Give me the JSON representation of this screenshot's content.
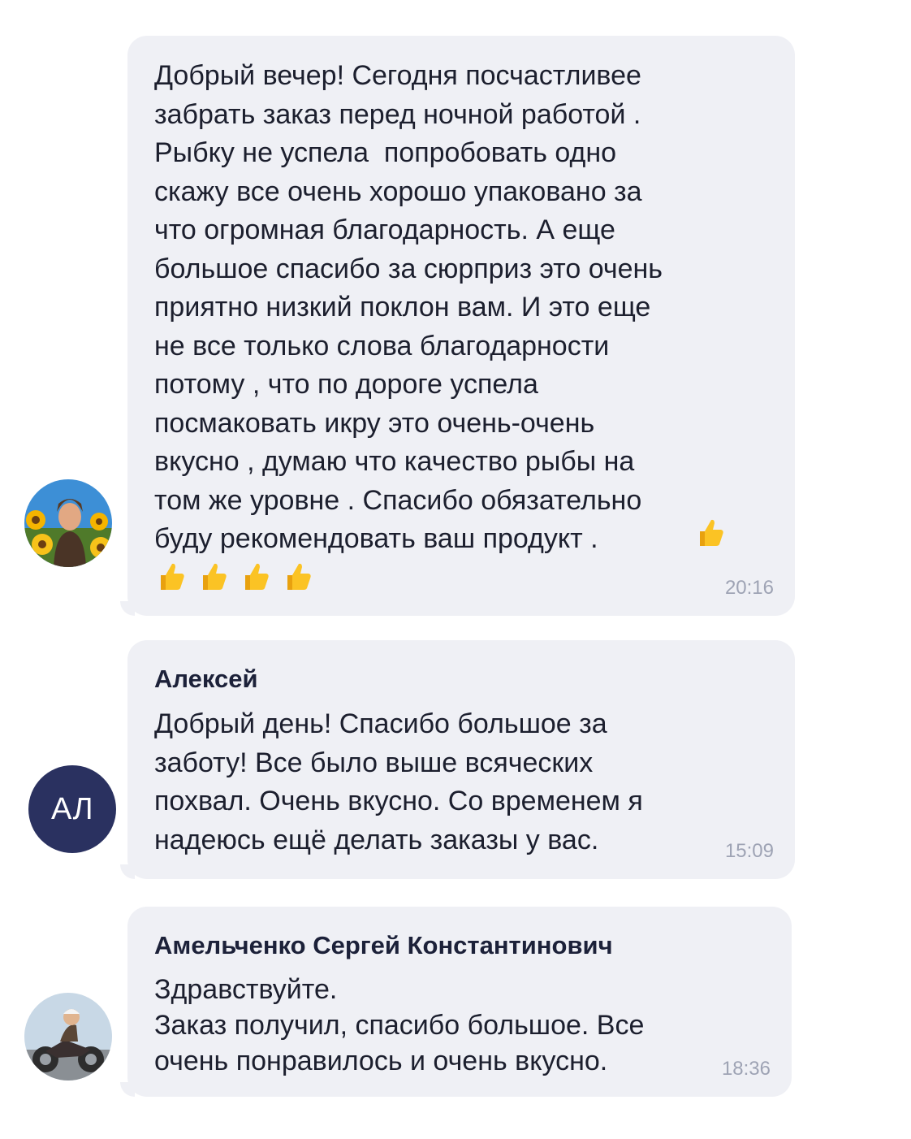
{
  "messages": [
    {
      "sender": "",
      "avatar": "avatar-photo-sunflowers",
      "text": "Добрый вечер! Сегодня посчастливее\nзабрать заказ перед ночной работой .\nРыбку не успела  попробовать одно\nскажу все очень хорошо упаковано за\nчто огромная благодарность. А еще\nбольшое спасибо за сюрприз это очень\nприятно низкий поклон вам. И это еще\nне все только слова благодарности\nпотому , что по дороге успела\nпосмаковать икру это очень-очень\nвкусно , думаю что качество рыбы на\nтом же уровне . Спасибо обязательно\nбуду рекомендовать ваш продукт .",
      "emoji": [
        "thumbs-up",
        "thumbs-up",
        "thumbs-up",
        "thumbs-up",
        "thumbs-up"
      ],
      "time": "20:16"
    },
    {
      "sender": "Алексей",
      "avatar_initials": "АЛ",
      "avatar_color": "#2a3160",
      "text": "Добрый день! Спасибо большое за\nзаботу! Все было выше всяческих\nпохвал. Очень вкусно. Со временем я\nнадеюсь ещё делать заказы у вас.",
      "time": "15:09"
    },
    {
      "sender": "Амельченко Сергей Константинович",
      "avatar": "avatar-photo-motorcycle",
      "text": "Здравствуйте.\nЗаказ получил, спасибо большое. Все\nочень понравилось и очень вкусно.",
      "time": "18:36"
    }
  ],
  "colors": {
    "bubble": "#eff0f5",
    "text": "#1c1f2e",
    "time": "#9ea3b4",
    "avatar_initials_bg": "#2a3160"
  }
}
